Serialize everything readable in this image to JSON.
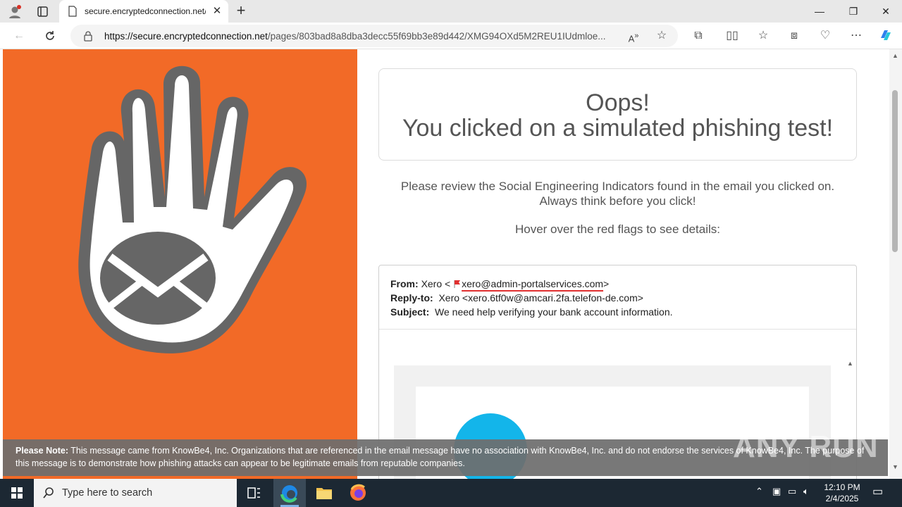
{
  "browser": {
    "tab_title": "secure.encryptedconnection.net/",
    "tab_close": "✕",
    "new_tab": "+",
    "url_host": "https://secure.encryptedconnection.net",
    "url_path": "/pages/803bad8a8dba3decc55f69bb3e89d442/XMG94OXd5M2REU1IUdmloe...",
    "window_buttons": {
      "minimize": "—",
      "restore": "❐",
      "close": "✕"
    }
  },
  "page": {
    "headline_1": "Oops!",
    "headline_2": "You clicked on a simulated phishing test!",
    "instruction_1": "Please review the Social Engineering Indicators found in the email you clicked on.",
    "instruction_2": "Always think before you click!",
    "hover_text": "Hover over the red flags to see details:",
    "email": {
      "from_label": "From:",
      "from_name": "Xero <",
      "from_address": "xero@admin-portalservices.com",
      "from_close": ">",
      "reply_label": "Reply-to:",
      "reply_value": "Xero <xero.6tf0w@amcari.2fa.telefon-de.com>",
      "subject_label": "Subject:",
      "subject_value": "We need help verifying your bank account information."
    },
    "note_label": "Please Note:",
    "note_text": "This message came from KnowBe4, Inc. Organizations that are referenced in the email message have no association with KnowBe4, Inc. and do not endorse the services of KnowBe4, Inc. The purpose of this message is to demonstrate how phishing attacks can appear to be legitimate emails from reputable companies."
  },
  "watermark": "ANY RUN",
  "taskbar": {
    "search_placeholder": "Type here to search",
    "time": "12:10 PM",
    "date": "2/4/2025"
  },
  "colors": {
    "brand_orange": "#f26a27",
    "hand_gray": "#666666",
    "flag_red": "#e03030",
    "xero_blue": "#13b5ea"
  }
}
